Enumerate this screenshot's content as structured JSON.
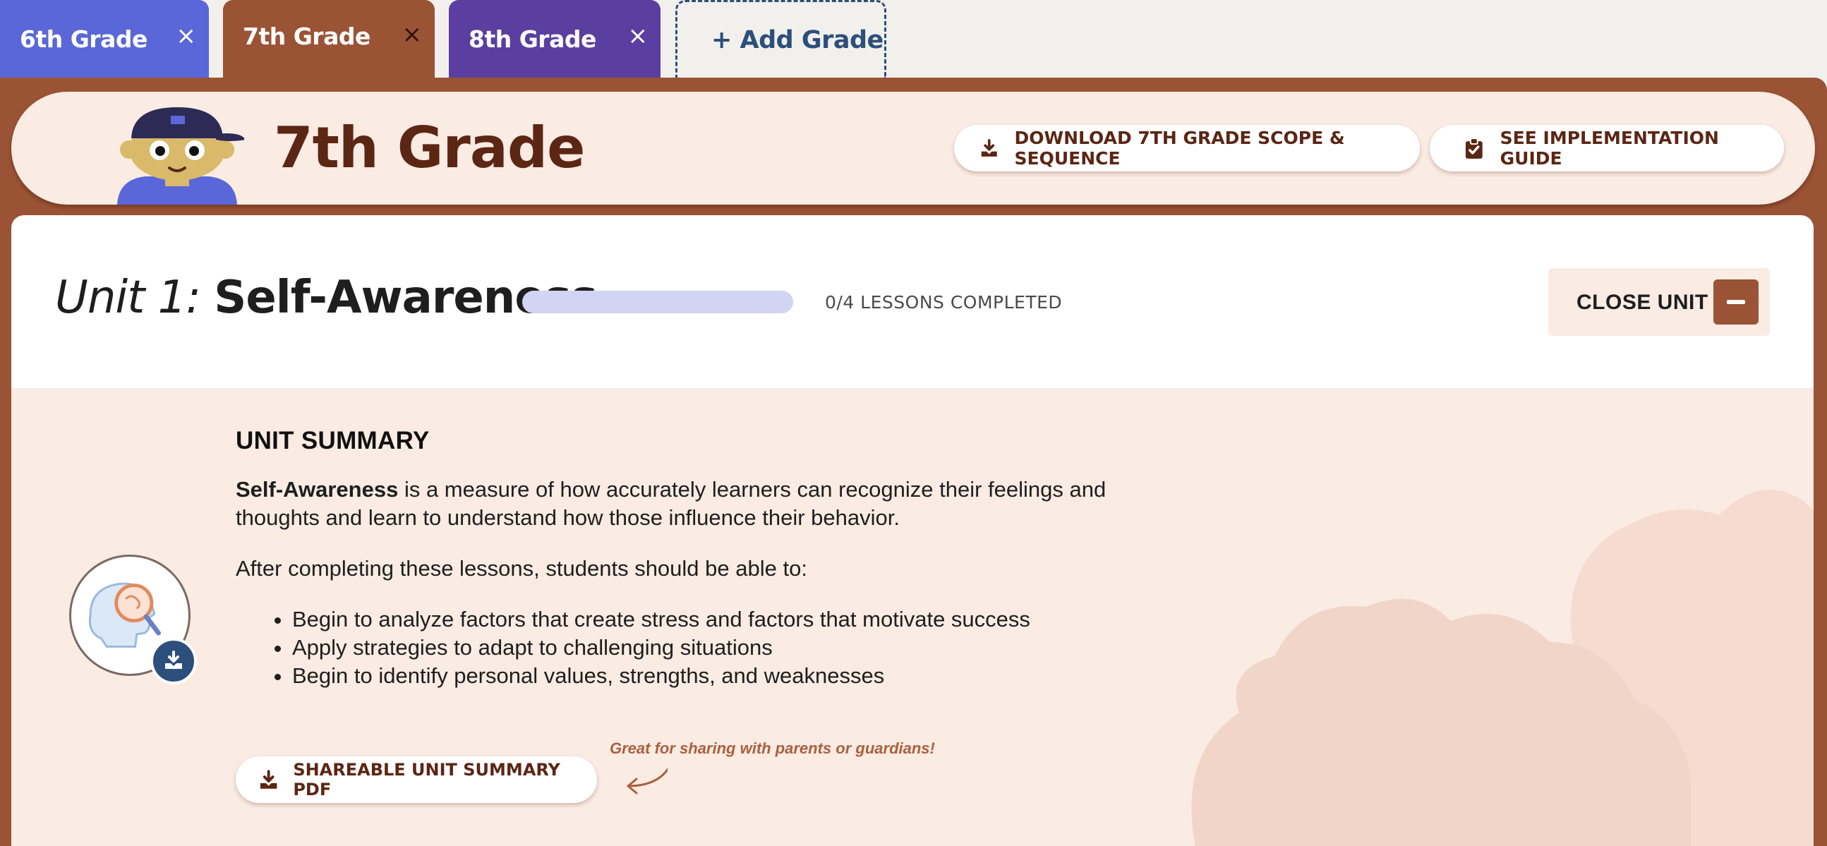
{
  "tabs": [
    {
      "label": "6th Grade",
      "close": "×"
    },
    {
      "label": "7th Grade",
      "close": "×"
    },
    {
      "label": "8th Grade",
      "close": "×"
    }
  ],
  "add_tab": {
    "label": "+ Add Grade"
  },
  "header": {
    "title": "7th Grade",
    "download_label": "DOWNLOAD 7TH GRADE SCOPE & SEQUENCE",
    "guide_label": "SEE IMPLEMENTATION GUIDE"
  },
  "unit": {
    "prefix": "Unit 1:",
    "name": "Self-Awareness",
    "lessons_completed": 0,
    "lessons_total": 4,
    "progress_text": "0/4 LESSONS COMPLETED",
    "close_label": "CLOSE UNIT"
  },
  "summary": {
    "heading": "UNIT SUMMARY",
    "term": "Self-Awareness",
    "definition": " is a measure of how accurately learners can recognize their feelings and thoughts and learn to understand how those influence their behavior.",
    "intro": "After completing these lessons, students should be able to:",
    "outcomes": [
      "Begin to analyze factors that create stress and factors that motivate success",
      "Apply strategies to adapt to challenging situations",
      "Begin to identify personal values, strengths, and weaknesses"
    ],
    "pdf_label": "SHAREABLE UNIT SUMMARY PDF",
    "note": "Great for sharing with parents or guardians!"
  },
  "colors": {
    "grade6": "#5a67d8",
    "grade7": "#9a5335",
    "grade8": "#5a3fa0",
    "add": "#2c4f7c",
    "header_bg": "#faebe3",
    "text_brown": "#5b2614"
  },
  "icons": [
    "close-icon",
    "download-icon",
    "clipboard-check-icon",
    "minus-icon",
    "head-magnifier-icon",
    "arrow-icon"
  ]
}
